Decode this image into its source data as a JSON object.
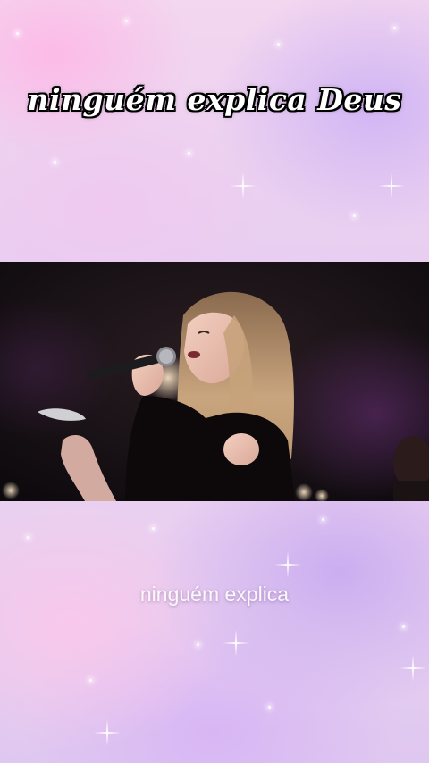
{
  "overlay": {
    "title": "ninguém explica Deus",
    "caption": "ninguém explica"
  },
  "video": {
    "description_icon": "singer-with-microphone-scene"
  },
  "colors": {
    "title_text": "#ffffff",
    "title_outline": "#000000",
    "caption_text": "#ffffff",
    "background_pink": "#f3d6ef",
    "background_lavender": "#dfc8f0",
    "video_dark": "#0c0a0d"
  }
}
